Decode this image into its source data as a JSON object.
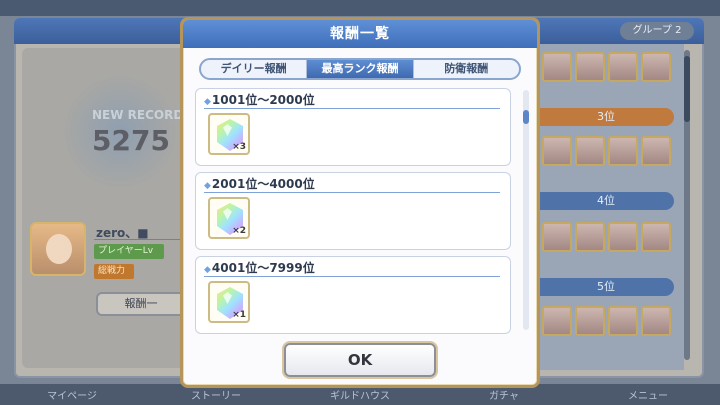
{
  "background": {
    "group_tab": "グループ 2",
    "new_record": "NEW RECORD",
    "score": "5275",
    "player_name": "zero、■",
    "player_lv": "プレイヤーLv",
    "power": "総戦力",
    "reward_button": "報酬一",
    "rank_bands": [
      "3位",
      "4位",
      "5位"
    ],
    "bottom_nav": [
      "マイページ",
      "ストーリー",
      "ギルドハウス",
      "ガチャ",
      "メニュー"
    ]
  },
  "modal": {
    "title": "報酬一覧",
    "tabs": [
      {
        "label": "デイリー報酬",
        "active": false
      },
      {
        "label": "最高ランク報酬",
        "active": true
      },
      {
        "label": "防衛報酬",
        "active": false
      }
    ],
    "rewards": [
      {
        "range": "1001位～2000位",
        "item": "jewel-crystal",
        "quantity": "×3"
      },
      {
        "range": "2001位～4000位",
        "item": "jewel-crystal",
        "quantity": "×2"
      },
      {
        "range": "4001位～7999位",
        "item": "jewel-crystal",
        "quantity": "×1"
      }
    ],
    "ok_label": "OK"
  },
  "colors": {
    "header": "#4f7fc8",
    "active_tab": "#4f7cc2",
    "frame_gold": "#b6955a"
  }
}
